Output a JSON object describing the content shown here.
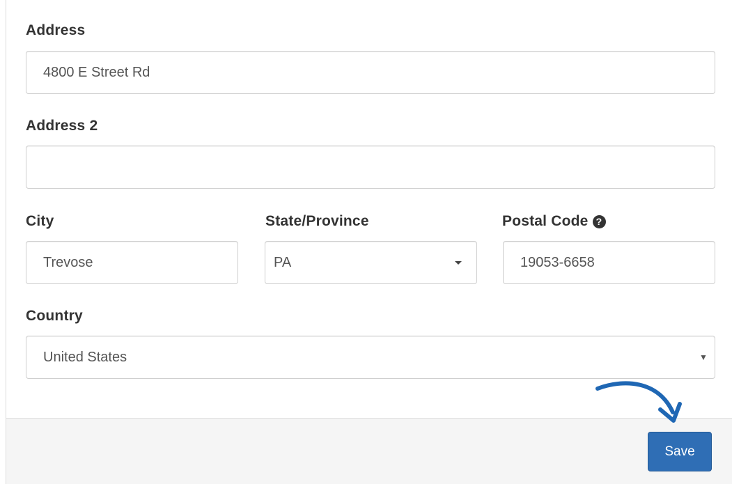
{
  "form": {
    "address": {
      "label": "Address",
      "value": "4800 E Street Rd"
    },
    "address2": {
      "label": "Address 2",
      "value": ""
    },
    "city": {
      "label": "City",
      "value": "Trevose"
    },
    "state": {
      "label": "State/Province",
      "selected": "PA"
    },
    "postal": {
      "label": "Postal Code",
      "help_icon": "question-circle-icon",
      "value": "19053-6658"
    },
    "country": {
      "label": "Country",
      "selected": "United States"
    }
  },
  "footer": {
    "save_label": "Save"
  },
  "colors": {
    "primary_button": "#2f6eb5",
    "annotation_arrow": "#1f67b4"
  }
}
